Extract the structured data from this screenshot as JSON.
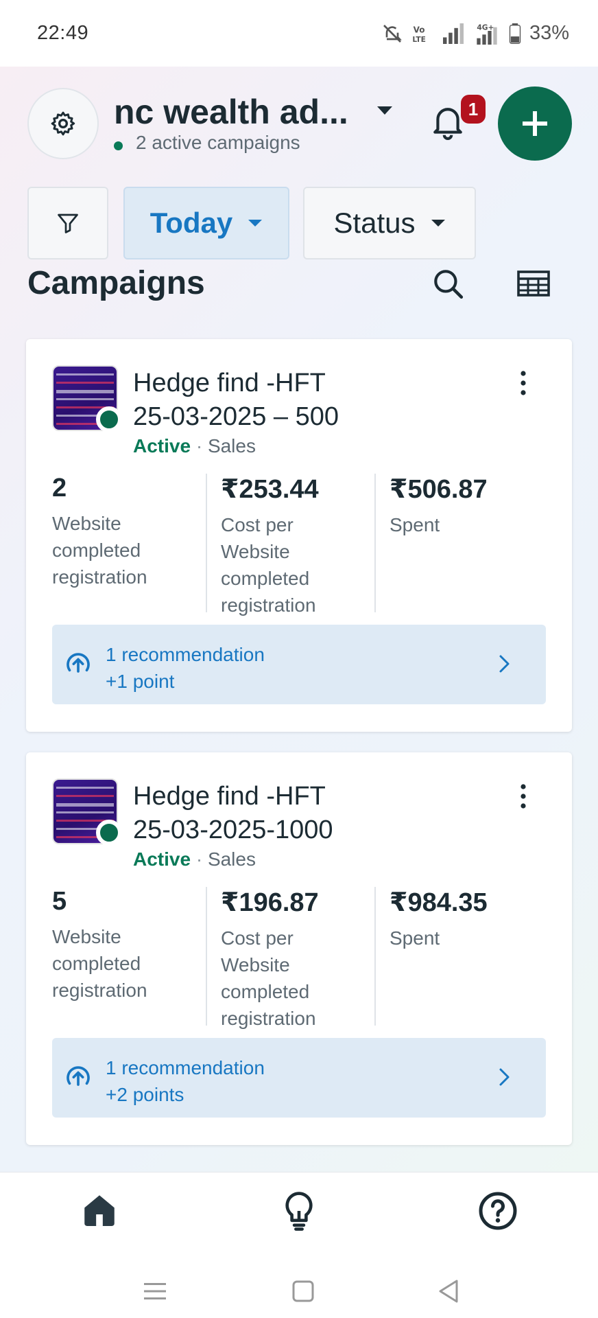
{
  "status_bar": {
    "time": "22:49",
    "battery": "33%",
    "icons": [
      "mute-bell-icon",
      "volte-icon",
      "signal-icon",
      "4g-signal-icon",
      "battery-icon"
    ]
  },
  "header": {
    "account_name": "nc wealth ad...",
    "active_campaigns": "2 active campaigns",
    "notification_count": "1"
  },
  "filters": {
    "date_label": "Today",
    "status_label": "Status"
  },
  "section": {
    "title": "Campaigns"
  },
  "campaigns": [
    {
      "title": "Hedge find -HFT\n25-03-2025 – 500",
      "status": "Active",
      "objective": "Sales",
      "metrics": [
        {
          "value": "2",
          "label": "Website completed registration"
        },
        {
          "value": "₹253.44",
          "label": "Cost per Website completed registration"
        },
        {
          "value": "₹506.87",
          "label": "Spent"
        }
      ],
      "recommendation": {
        "line1": "1 recommendation",
        "line2": "+1 point"
      }
    },
    {
      "title": "Hedge find -HFT\n25-03-2025-1000",
      "status": "Active",
      "objective": "Sales",
      "metrics": [
        {
          "value": "5",
          "label": "Website completed registration"
        },
        {
          "value": "₹196.87",
          "label": "Cost per Website completed registration"
        },
        {
          "value": "₹984.35",
          "label": "Spent"
        }
      ],
      "recommendation": {
        "line1": "1 recommendation",
        "line2": "+2 points"
      }
    }
  ],
  "bottom_nav": [
    "home-icon",
    "lightbulb-icon",
    "help-icon"
  ],
  "colors": {
    "brand_green": "#0b6b4e",
    "link_blue": "#1877c2",
    "badge_red": "#b3121e",
    "status_green": "#0a7a58"
  }
}
